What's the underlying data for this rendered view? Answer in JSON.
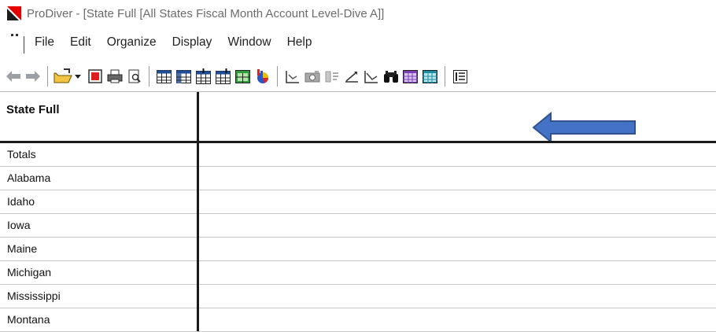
{
  "window": {
    "title": "ProDiver - [State Full [All States Fiscal Month Account Level-Dive A]]",
    "accent_color": "#e60000"
  },
  "menubar": {
    "items": [
      "File",
      "Edit",
      "Organize",
      "Display",
      "Window",
      "Help"
    ]
  },
  "toolbar": {
    "buttons": [
      "back-arrow-icon",
      "forward-arrow-icon",
      "open-folder-icon",
      "dropdown-icon",
      "close-dive-icon",
      "print-icon",
      "print-preview-icon",
      "table-icon",
      "table-alt-icon",
      "insert-column-icon",
      "insert-row-icon",
      "green-grid-icon",
      "chart-3d-icon",
      "line-chart-icon",
      "camera-icon",
      "multi-column-icon",
      "trend-line-icon",
      "decline-chart-icon",
      "binoculars-icon",
      "purple-grid-icon",
      "teal-grid-icon",
      "info-grid-icon"
    ]
  },
  "grid": {
    "column_header": "State Full",
    "rows": [
      "Totals",
      "Alabama",
      "Idaho",
      "Iowa",
      "Maine",
      "Michigan",
      "Mississippi",
      "Montana"
    ]
  },
  "annotation": {
    "arrow_color": "#4472c4",
    "arrow_direction": "left"
  }
}
